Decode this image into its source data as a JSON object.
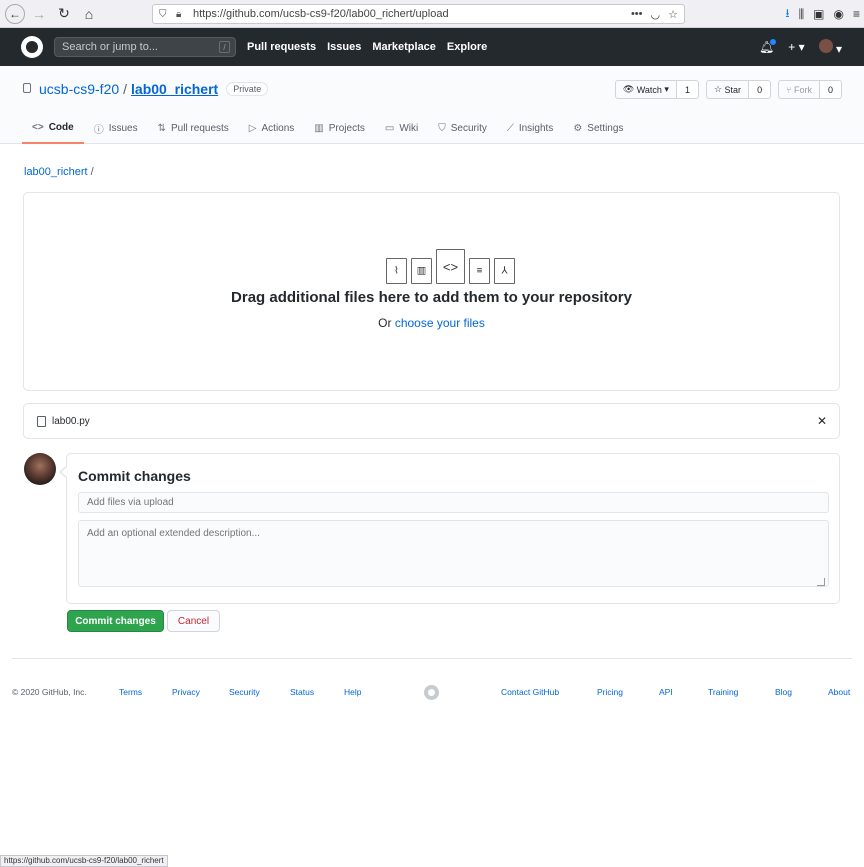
{
  "browser": {
    "url": "https://github.com/ucsb-cs9-f20/lab00_richert/upload"
  },
  "header": {
    "search_placeholder": "Search or jump to...",
    "search_key": "/",
    "nav": [
      "Pull requests",
      "Issues",
      "Marketplace",
      "Explore"
    ]
  },
  "repo": {
    "owner": "ucsb-cs9-f20",
    "separator": "/",
    "name": "lab00_richert",
    "visibility": "Private",
    "watch_label": "Watch",
    "watch_count": "1",
    "star_label": "Star",
    "star_count": "0",
    "fork_label": "Fork",
    "fork_count": "0",
    "tabs": [
      {
        "label": "Code",
        "icon": "code-icon",
        "glyph": "<>"
      },
      {
        "label": "Issues",
        "icon": "issue-icon",
        "glyph": "ⓘ"
      },
      {
        "label": "Pull requests",
        "icon": "pull-request-icon",
        "glyph": "⇅"
      },
      {
        "label": "Actions",
        "icon": "play-icon",
        "glyph": "▷"
      },
      {
        "label": "Projects",
        "icon": "project-icon",
        "glyph": "▥"
      },
      {
        "label": "Wiki",
        "icon": "book-icon",
        "glyph": "▭"
      },
      {
        "label": "Security",
        "icon": "shield-icon",
        "glyph": "⛉"
      },
      {
        "label": "Insights",
        "icon": "graph-icon",
        "glyph": "⟋"
      },
      {
        "label": "Settings",
        "icon": "gear-icon",
        "glyph": "⚙"
      }
    ]
  },
  "breadcrumb": {
    "repo_link": "lab00_richert",
    "separator": "/"
  },
  "dropzone": {
    "title": "Drag additional files here to add them to your repository",
    "or_text": "Or ",
    "choose_link": "choose your files"
  },
  "uploaded_file": {
    "name": "lab00.py"
  },
  "commit": {
    "heading": "Commit changes",
    "summary_placeholder": "Add files via upload",
    "description_placeholder": "Add an optional extended description...",
    "commit_button": "Commit changes",
    "cancel_button": "Cancel"
  },
  "footer": {
    "copyright": "© 2020 GitHub, Inc.",
    "links": [
      "Terms",
      "Privacy",
      "Security",
      "Status",
      "Help",
      "Contact GitHub",
      "Pricing",
      "API",
      "Training",
      "Blog",
      "About"
    ]
  },
  "status_bar": {
    "text": "https://github.com/ucsb-cs9-f20/lab00_richert"
  }
}
